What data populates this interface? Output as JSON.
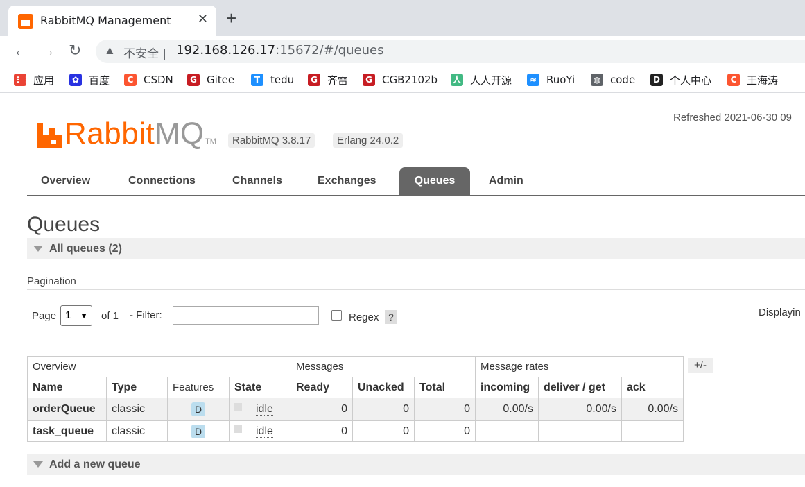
{
  "browser": {
    "tab_title": "RabbitMQ Management",
    "insecure_label": "不安全",
    "url_host": "192.168.126.17",
    "url_rest": ":15672/#/queues"
  },
  "bookmarks": [
    {
      "label": "应用",
      "icon": "apps-grid-icon",
      "color": "#ea4335"
    },
    {
      "label": "百度",
      "icon": "baidu-paw-icon",
      "color": "#2932e1"
    },
    {
      "label": "CSDN",
      "icon": "csdn-icon",
      "color": "#fc5531"
    },
    {
      "label": "Gitee",
      "icon": "gitee-icon",
      "color": "#c71d23"
    },
    {
      "label": "tedu",
      "icon": "tedu-icon",
      "color": "#1e90ff"
    },
    {
      "label": "齐雷",
      "icon": "gitee-icon",
      "color": "#c71d23"
    },
    {
      "label": "CGB2102b",
      "icon": "gitee-icon",
      "color": "#c71d23"
    },
    {
      "label": "人人开源",
      "icon": "renren-icon",
      "color": "#42b983"
    },
    {
      "label": "RuoYi",
      "icon": "ruoyi-icon",
      "color": "#1e90ff"
    },
    {
      "label": "code",
      "icon": "globe-icon",
      "color": "#5f6368"
    },
    {
      "label": "个人中心",
      "icon": "profile-icon",
      "color": "#222222"
    },
    {
      "label": "王海涛",
      "icon": "csdn-icon",
      "color": "#fc5531"
    }
  ],
  "header": {
    "logo_rabbit": "Rabbit",
    "logo_mq": "MQ",
    "logo_tm": "TM",
    "rabbitmq_version": "RabbitMQ 3.8.17",
    "erlang_version": "Erlang 24.0.2",
    "refreshed": "Refreshed 2021-06-30 09"
  },
  "nav_tabs": [
    {
      "label": "Overview"
    },
    {
      "label": "Connections"
    },
    {
      "label": "Channels"
    },
    {
      "label": "Exchanges"
    },
    {
      "label": "Queues",
      "active": true
    },
    {
      "label": "Admin"
    }
  ],
  "page_title": "Queues",
  "all_queues_label": "All queues (2)",
  "pagination": {
    "label": "Pagination",
    "page_label": "Page",
    "page_value": "1",
    "of_label": "of 1",
    "filter_label": "- Filter:",
    "filter_value": "",
    "regex_label": "Regex",
    "help_label": "?",
    "displaying": "Displayin"
  },
  "table": {
    "groups": {
      "overview": "Overview",
      "messages": "Messages",
      "rates": "Message rates"
    },
    "columns": [
      "Name",
      "Type",
      "Features",
      "State",
      "Ready",
      "Unacked",
      "Total",
      "incoming",
      "deliver / get",
      "ack"
    ],
    "toggle_label": "+/-",
    "rows": [
      {
        "name": "orderQueue",
        "type": "classic",
        "feature": "D",
        "state": "idle",
        "ready": "0",
        "unacked": "0",
        "total": "0",
        "incoming": "0.00/s",
        "deliver_get": "0.00/s",
        "ack": "0.00/s"
      },
      {
        "name": "task_queue",
        "type": "classic",
        "feature": "D",
        "state": "idle",
        "ready": "0",
        "unacked": "0",
        "total": "0",
        "incoming": "",
        "deliver_get": "",
        "ack": ""
      }
    ]
  },
  "add_queue_label": "Add a new queue",
  "colors": {
    "accent": "#ff6600",
    "active_tab": "#666666",
    "feature_badge": "#bbddee"
  }
}
